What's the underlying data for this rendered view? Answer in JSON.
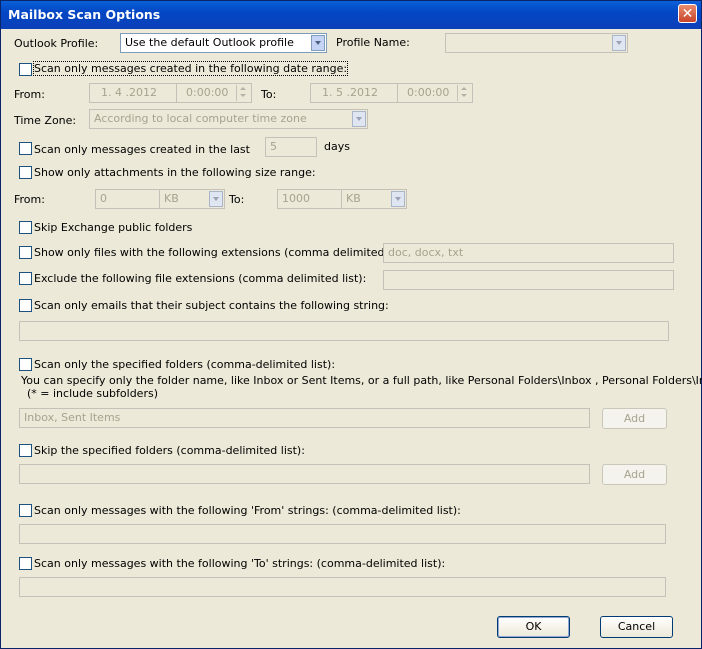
{
  "window": {
    "title": "Mailbox Scan Options",
    "close": "✕"
  },
  "profile": {
    "outlook_label": "Outlook Profile:",
    "outlook_value": "Use the default Outlook profile",
    "name_label": "Profile Name:",
    "name_value": ""
  },
  "date_range": {
    "checkbox_label": "Scan only messages created in the following date range:",
    "from_label": "From:",
    "from_date": "1. 4 .2012",
    "from_time": "0:00:00",
    "to_label": "To:",
    "to_date": "1. 5 .2012",
    "to_time": "0:00:00"
  },
  "time_zone": {
    "label": "Time Zone:",
    "value": "According to local computer time zone"
  },
  "last_days": {
    "checkbox_label": "Scan only messages created in the last",
    "value": "5",
    "unit": "days"
  },
  "size_range": {
    "checkbox_label": "Show only attachments in the following size range:",
    "from_label": "From:",
    "from_value": "0",
    "from_unit": "KB",
    "to_label": "To:",
    "to_value": "1000",
    "to_unit": "KB"
  },
  "options": {
    "skip_public": "Skip Exchange public folders",
    "include_ext_label": "Show only files with the following extensions (comma delimited list):",
    "include_ext_value": "doc, docx, txt",
    "exclude_ext_label": "Exclude the following file extensions (comma delimited list):",
    "exclude_ext_value": "",
    "subject_label": "Scan only emails that their subject contains the following string:",
    "subject_value": ""
  },
  "folders": {
    "specified_label": "Scan only the specified folders (comma-delimited list):",
    "hint_line1": "You can specify only the folder name, like Inbox or Sent Items, or a full path, like Personal Folders\\Inbox , Personal Folders\\Inbox*",
    "hint_line2": "(* = include subfolders)",
    "specified_value": "Inbox, Sent Items",
    "add_label": "Add",
    "skip_label": "Skip the specified folders (comma-delimited list):",
    "skip_value": "",
    "skip_add_label": "Add"
  },
  "strings": {
    "from_label": "Scan only messages with the following 'From' strings: (comma-delimited list):",
    "from_value": "",
    "to_label": "Scan only messages with the following 'To' strings: (comma-delimited list):",
    "to_value": ""
  },
  "buttons": {
    "ok": "OK",
    "cancel": "Cancel"
  }
}
